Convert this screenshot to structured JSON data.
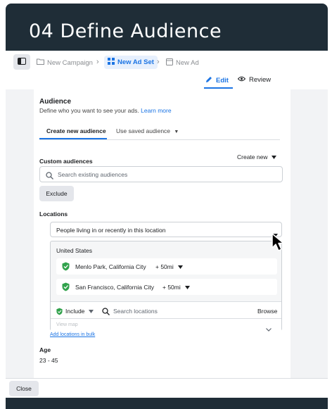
{
  "header": {
    "title": "04 Define Audience"
  },
  "breadcrumb": {
    "items": [
      {
        "label": "New Campaign"
      },
      {
        "label": "New Ad Set"
      },
      {
        "label": "New Ad"
      }
    ]
  },
  "mode_tabs": {
    "edit": "Edit",
    "review": "Review"
  },
  "audience": {
    "title": "Audience",
    "description": "Define who you want to see your ads.",
    "learn_more": "Learn more",
    "tabs": {
      "create": "Create new audience",
      "saved": "Use saved audience"
    }
  },
  "custom_audiences": {
    "label": "Custom audiences",
    "create_new": "Create new",
    "search_placeholder": "Search existing audiences",
    "exclude_button": "Exclude"
  },
  "locations": {
    "label": "Locations",
    "selector_value": "People living in or recently in this location",
    "country": "United States",
    "items": [
      {
        "name": "Menlo Park, California City",
        "radius": "+ 50mi"
      },
      {
        "name": "San Francisco, California City",
        "radius": "+ 50mi"
      }
    ],
    "include_label": "Include",
    "search_placeholder": "Search locations",
    "browse": "Browse",
    "view_map": "View map",
    "bulk_link": "Add locations in bulk"
  },
  "age": {
    "label": "Age",
    "value": "23 - 45"
  },
  "footer": {
    "close_button": "Close"
  },
  "colors": {
    "accent": "#1b74e4",
    "header_bg": "#1f2d37",
    "pin_green": "#31a24c"
  }
}
